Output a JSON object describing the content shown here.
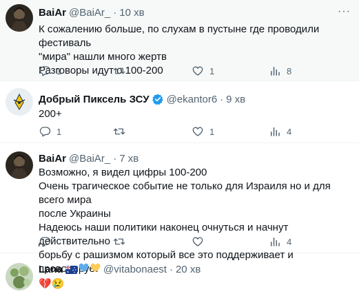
{
  "tweets": [
    {
      "name": "BaiAr",
      "handle": "@BaiAr_",
      "sep": "·",
      "time": "10 хв",
      "lines": [
        "К сожалению больше, по слухам в пустыне где проводили фестиваль",
        "\"мира\" нашли много жертв",
        "Разговоры идут о 100-200"
      ],
      "reply_count": "1",
      "retweet_count": "",
      "like_count": "1",
      "view_count": "8"
    },
    {
      "name": "Добрый Пиксель ЗСУ",
      "handle": "@ekantor6",
      "sep": "·",
      "time": "9 хв",
      "lines": [
        "200+"
      ],
      "reply_count": "1",
      "retweet_count": "",
      "like_count": "1",
      "view_count": "4"
    },
    {
      "name": "BaiAr",
      "handle": "@BaiAr_",
      "sep": "·",
      "time": "7 хв",
      "lines": [
        "Возможно, я видел цифры 100-200",
        "Очень трагическое событие не только для Израиля но и для всего мира",
        "после Украины",
        "Надеюсь наши политики наконец очнуться и начнут действительно",
        "борьбу с рашизмом который все это поддерживает и провоцирует"
      ],
      "reply_count": "",
      "retweet_count": "",
      "like_count": "",
      "view_count": "4"
    },
    {
      "name": "Lana",
      "handle": "@vitabonaest",
      "sep": "·",
      "time": "20 хв",
      "lines": [
        "💔😢"
      ]
    }
  ],
  "more_label": "···",
  "colors": {
    "text": "#0f1419",
    "muted": "#536471",
    "verified": "#1d9bf0",
    "highlight_bg": "#f7f9f9"
  },
  "icons": [
    "reply-icon",
    "retweet-icon",
    "like-icon",
    "views-icon",
    "verified-badge-icon",
    "australia-flag-icon",
    "blue-heart-icon",
    "yellow-heart-icon",
    "more-icon"
  ]
}
